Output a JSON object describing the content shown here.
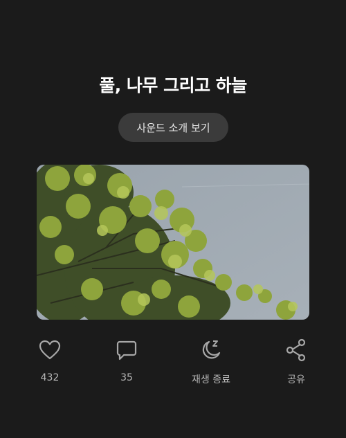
{
  "header": {
    "title": "풀, 나무 그리고 하늘",
    "intro_button": "사운드 소개 보기"
  },
  "artwork": {
    "description_icon": "trees-and-sky-photo"
  },
  "actions": [
    {
      "icon": "heart-icon",
      "label": "432"
    },
    {
      "icon": "comment-icon",
      "label": "35"
    },
    {
      "icon": "sleep-timer-icon",
      "label": "재생 종료"
    },
    {
      "icon": "share-icon",
      "label": "공유"
    }
  ],
  "colors": {
    "background": "#1b1b1b",
    "button_bg": "#3b3b3b",
    "icon": "#a8a8a8",
    "label": "#b9b9b9"
  }
}
